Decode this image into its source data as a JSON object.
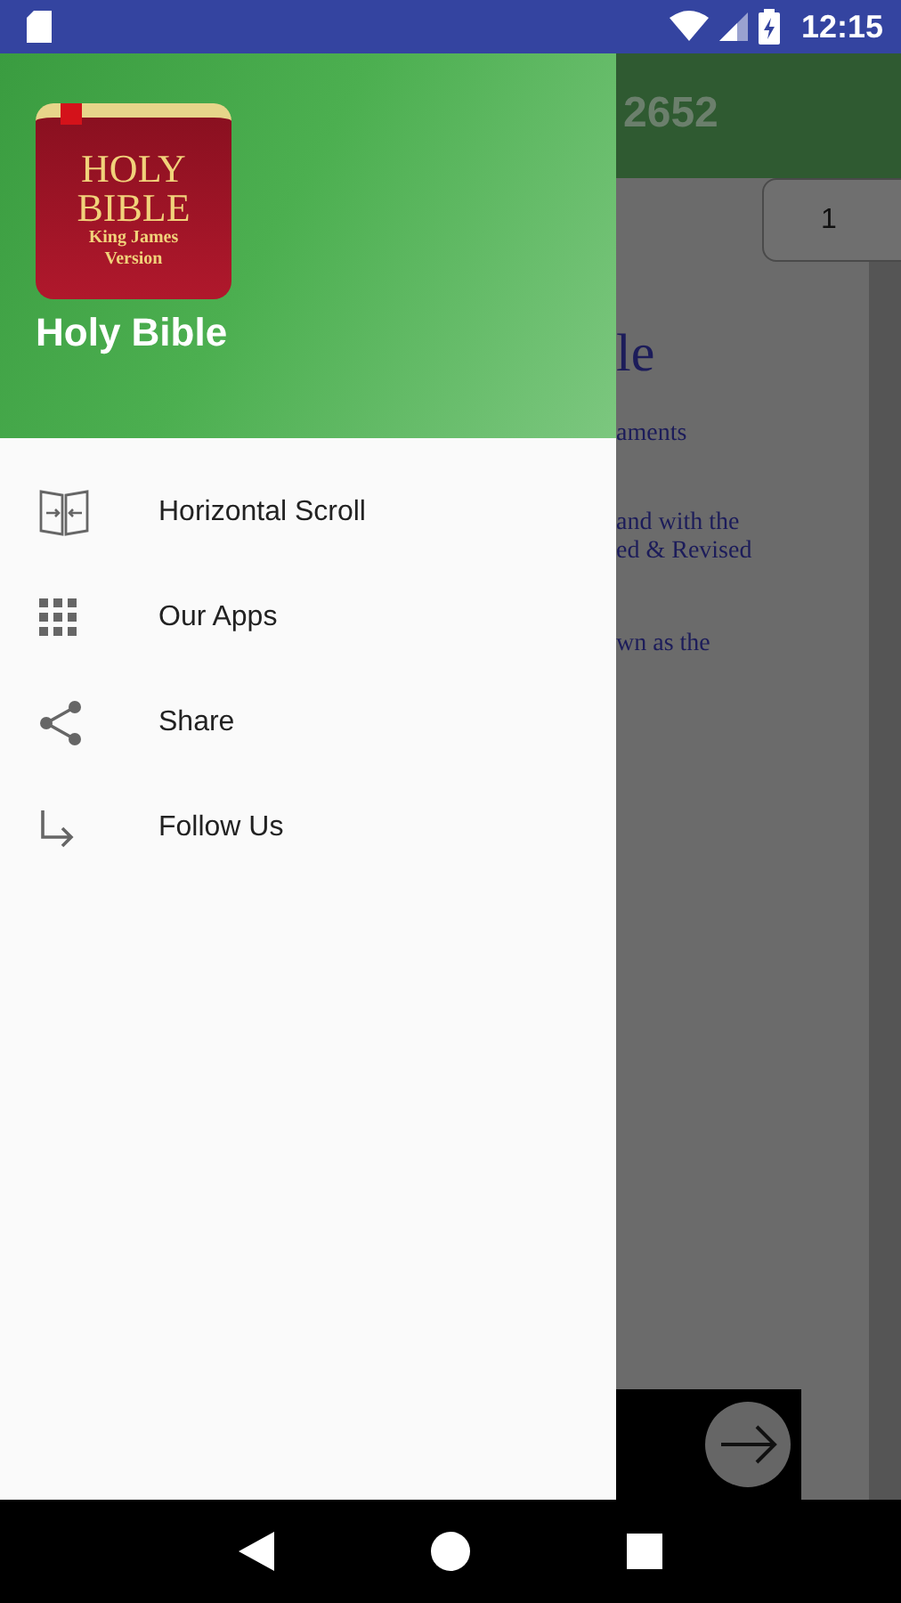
{
  "status_bar": {
    "time": "12:15"
  },
  "background": {
    "toolbar_title": "2652",
    "page_tab": "1",
    "heading": "le",
    "lines": [
      "aments",
      "and with the",
      "ed & Revised",
      "wn as the"
    ]
  },
  "drawer": {
    "app_name": "Holy Bible",
    "logo": {
      "line_1": "HOLY",
      "line_2": "BIBLE",
      "line_3": "King James",
      "line_4": "Version"
    },
    "items": [
      {
        "label": "Horizontal Scroll",
        "kind": "book"
      },
      {
        "label": "Our Apps",
        "kind": "grid"
      },
      {
        "label": "Share",
        "kind": "share"
      },
      {
        "label": "Follow Us",
        "kind": "arrow"
      }
    ]
  }
}
